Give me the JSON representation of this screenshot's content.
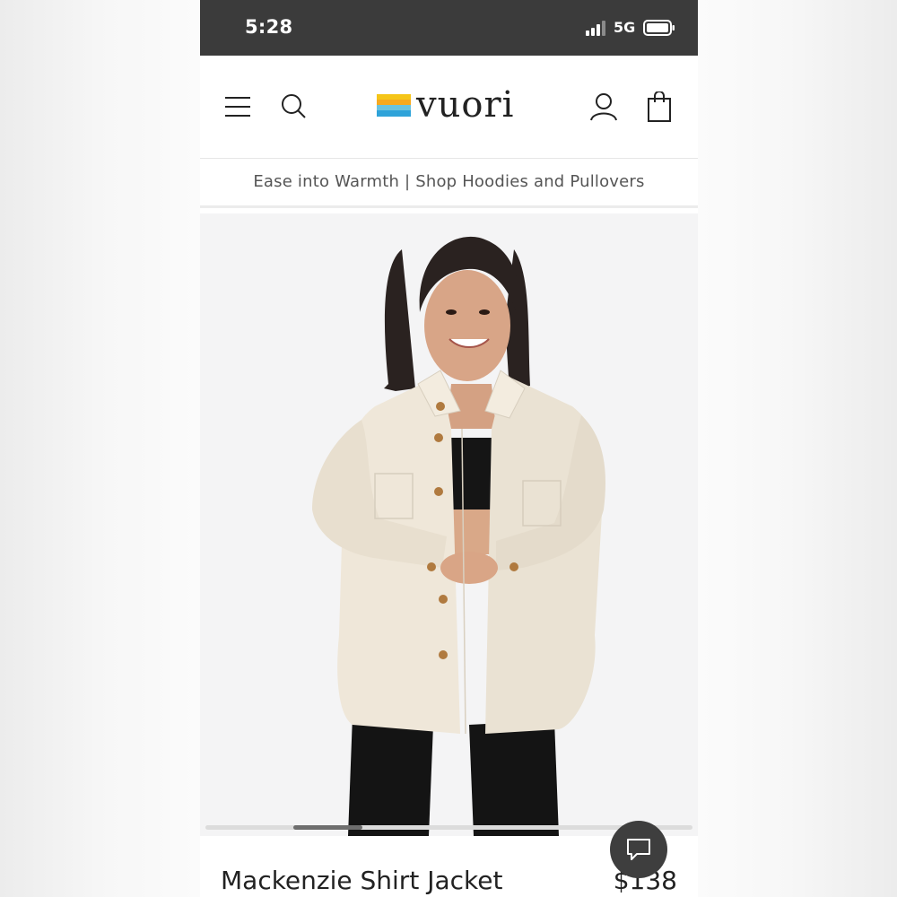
{
  "status_bar": {
    "time": "5:28",
    "network": "5G",
    "icons": [
      "signal-bars-icon",
      "battery-icon"
    ]
  },
  "header": {
    "logo_text": "vuori",
    "icons": [
      "hamburger-menu-icon",
      "search-icon",
      "account-icon",
      "shopping-bag-icon"
    ]
  },
  "promo_banner": {
    "text": "Ease into Warmth | Shop Hoodies and Pullovers"
  },
  "product": {
    "name": "Mackenzie Shirt Jacket",
    "price": "$138",
    "image_description_icon": "product-photo"
  },
  "carousel": {
    "current_index": 2,
    "progress_fraction": 0.21
  },
  "chat": {
    "icon": "chat-bubble-icon"
  },
  "colors": {
    "status_bar_bg": "#3b3b3b",
    "text_primary": "#222222",
    "promo_text": "#555555",
    "image_bg": "#f4f4f5",
    "chat_button_bg": "#3e3e3e",
    "logo_stripe_yellow": "#f5c518",
    "logo_stripe_blue": "#2fa3d9"
  }
}
